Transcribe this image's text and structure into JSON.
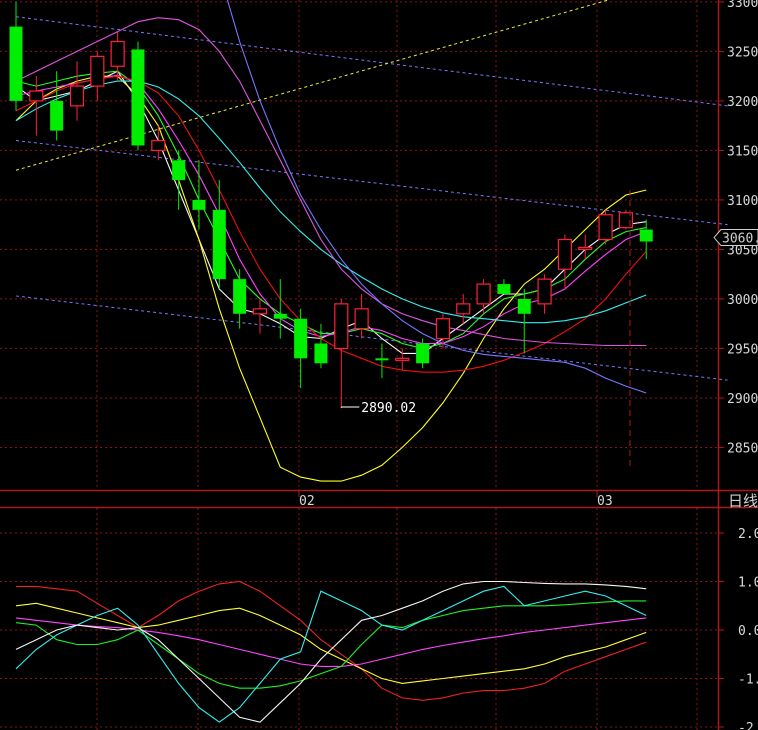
{
  "chart_title": "",
  "period_label": "日线",
  "colors": {
    "background": "#000000",
    "frame": "#b01818",
    "grid": "#8a1515",
    "up": "#ff1f3c",
    "down": "#00ee00"
  },
  "chart_data": [
    {
      "type": "candlestick",
      "panel": "price",
      "title": "",
      "ylim": [
        2805,
        3310
      ],
      "y_ticks": [
        "2850.",
        "2900.",
        "2950.",
        "3000.",
        "3050.",
        "3100.",
        "3150.",
        "3200.",
        "3250.",
        "3300."
      ],
      "y_tick_values": [
        2850,
        2900,
        2950,
        3000,
        3050,
        3100,
        3150,
        3200,
        3250,
        3300
      ],
      "x_ticks": [
        {
          "label": "02",
          "index": 14.5
        },
        {
          "label": "03",
          "index": 29.5
        }
      ],
      "current_price_label": "3060.",
      "current_price": 3062,
      "low_annotation": {
        "text": "2890.02",
        "index": 16,
        "value": 2890.02
      },
      "candles": [
        {
          "o": 3275,
          "h": 3300,
          "l": 3190,
          "c": 3200
        },
        {
          "o": 3200,
          "h": 3225,
          "l": 3165,
          "c": 3210
        },
        {
          "o": 3200,
          "h": 3230,
          "l": 3160,
          "c": 3170
        },
        {
          "o": 3195,
          "h": 3240,
          "l": 3180,
          "c": 3215
        },
        {
          "o": 3215,
          "h": 3250,
          "l": 3200,
          "c": 3245
        },
        {
          "o": 3235,
          "h": 3270,
          "l": 3220,
          "c": 3260
        },
        {
          "o": 3252,
          "h": 3260,
          "l": 3150,
          "c": 3155
        },
        {
          "o": 3150,
          "h": 3175,
          "l": 3140,
          "c": 3160
        },
        {
          "o": 3140,
          "h": 3150,
          "l": 3090,
          "c": 3120
        },
        {
          "o": 3100,
          "h": 3140,
          "l": 3070,
          "c": 3090
        },
        {
          "o": 3090,
          "h": 3120,
          "l": 3010,
          "c": 3020
        },
        {
          "o": 3020,
          "h": 3030,
          "l": 2970,
          "c": 2985
        },
        {
          "o": 2985,
          "h": 3000,
          "l": 2965,
          "c": 2990
        },
        {
          "o": 2985,
          "h": 3020,
          "l": 2960,
          "c": 2980
        },
        {
          "o": 2980,
          "h": 2990,
          "l": 2910,
          "c": 2940
        },
        {
          "o": 2955,
          "h": 2975,
          "l": 2930,
          "c": 2935
        },
        {
          "o": 2950,
          "h": 3000,
          "l": 2890.02,
          "c": 2995
        },
        {
          "o": 2970,
          "h": 3005,
          "l": 2960,
          "c": 2990
        },
        {
          "o": 2940,
          "h": 2955,
          "l": 2920,
          "c": 2938
        },
        {
          "o": 2938,
          "h": 2950,
          "l": 2928,
          "c": 2940
        },
        {
          "o": 2955,
          "h": 2960,
          "l": 2930,
          "c": 2935
        },
        {
          "o": 2960,
          "h": 2985,
          "l": 2950,
          "c": 2980
        },
        {
          "o": 2985,
          "h": 3005,
          "l": 2975,
          "c": 2995
        },
        {
          "o": 2995,
          "h": 3020,
          "l": 2985,
          "c": 3015
        },
        {
          "o": 3015,
          "h": 3020,
          "l": 3005,
          "c": 3005
        },
        {
          "o": 3000,
          "h": 3010,
          "l": 2945,
          "c": 2985
        },
        {
          "o": 2995,
          "h": 3025,
          "l": 2985,
          "c": 3020
        },
        {
          "o": 3030,
          "h": 3065,
          "l": 3010,
          "c": 3060
        },
        {
          "o": 3050,
          "h": 3065,
          "l": 3040,
          "c": 3052
        },
        {
          "o": 3060,
          "h": 3090,
          "l": 3055,
          "c": 3085
        },
        {
          "o": 3072,
          "h": 3090,
          "l": 3070,
          "c": 3087
        },
        {
          "o": 3070,
          "h": 3080,
          "l": 3040,
          "c": 3058
        }
      ],
      "overlays": [
        {
          "color": "#f5f5f5",
          "values": [
            3215,
            3200,
            3205,
            3210,
            3220,
            3230,
            3200,
            3160,
            3110,
            3060,
            3010,
            2990,
            2985,
            2975,
            2962,
            2960,
            2970,
            2978,
            2960,
            2945,
            2945,
            2960,
            2975,
            2990,
            3005,
            3005,
            3010,
            3030,
            3050,
            3065,
            3075,
            3078
          ]
        },
        {
          "color": "#ffff22",
          "values": [
            3180,
            3200,
            3212,
            3220,
            3225,
            3225,
            3205,
            3175,
            3120,
            3060,
            2990,
            2930,
            2880,
            2830,
            2820,
            2816,
            2816,
            2822,
            2832,
            2850,
            2870,
            2895,
            2925,
            2960,
            2990,
            3015,
            3030,
            3050,
            3070,
            3090,
            3105,
            3110
          ]
        },
        {
          "color": "#22ff22",
          "values": [
            3220,
            3215,
            3220,
            3225,
            3228,
            3230,
            3215,
            3185,
            3145,
            3100,
            3060,
            3020,
            3000,
            2985,
            2975,
            2965,
            2965,
            2970,
            2965,
            2955,
            2950,
            2955,
            2965,
            2985,
            3000,
            3005,
            3010,
            3020,
            3040,
            3058,
            3068,
            3072
          ]
        },
        {
          "color": "#ff44ff",
          "values": [
            3205,
            3210,
            3214,
            3218,
            3222,
            3226,
            3218,
            3192,
            3160,
            3125,
            3085,
            3040,
            3005,
            2980,
            2968,
            2962,
            2966,
            2972,
            2968,
            2960,
            2955,
            2955,
            2962,
            2972,
            2985,
            2995,
            3000,
            3010,
            3028,
            3045,
            3060,
            3068
          ]
        },
        {
          "color": "#ee1111",
          "values": [
            3190,
            3200,
            3210,
            3218,
            3222,
            3225,
            3220,
            3208,
            3185,
            3150,
            3110,
            3068,
            3030,
            3000,
            2978,
            2960,
            2948,
            2940,
            2932,
            2928,
            2926,
            2926,
            2928,
            2932,
            2938,
            2946,
            2955,
            2967,
            2980,
            3000,
            3025,
            3048
          ]
        },
        {
          "color": "#33eeee",
          "values": [
            3180,
            3192,
            3202,
            3210,
            3216,
            3220,
            3220,
            3214,
            3202,
            3185,
            3162,
            3138,
            3112,
            3088,
            3068,
            3050,
            3035,
            3022,
            3010,
            3000,
            2992,
            2986,
            2982,
            2980,
            2978,
            2976,
            2976,
            2978,
            2982,
            2988,
            2996,
            3004
          ]
        },
        {
          "color": "#dd55dd",
          "values": [
            3220,
            3230,
            3240,
            3250,
            3260,
            3270,
            3280,
            3284,
            3282,
            3272,
            3250,
            3220,
            3180,
            3140,
            3100,
            3060,
            3030,
            3010,
            2995,
            2985,
            2978,
            2972,
            2968,
            2964,
            2960,
            2958,
            2956,
            2955,
            2954,
            2953,
            2953,
            2953
          ]
        },
        {
          "color": "#7777ff",
          "values": [
            3420,
            3450,
            3480,
            3510,
            3530,
            3540,
            3530,
            3500,
            3460,
            3400,
            3330,
            3260,
            3200,
            3150,
            3105,
            3070,
            3040,
            3015,
            2995,
            2978,
            2965,
            2955,
            2948,
            2944,
            2942,
            2940,
            2938,
            2936,
            2930,
            2920,
            2912,
            2905
          ]
        }
      ],
      "trend_lines": [
        {
          "color": "#7777ff",
          "style": "dash",
          "from": [
            0,
            3285
          ],
          "to": [
            35,
            3195
          ]
        },
        {
          "color": "#7777ff",
          "style": "dash",
          "from": [
            0,
            3160
          ],
          "to": [
            35,
            3075
          ]
        },
        {
          "color": "#7777ff",
          "style": "dash",
          "from": [
            0,
            3003
          ],
          "to": [
            35,
            2918
          ]
        },
        {
          "color": "#eeee33",
          "style": "dash",
          "from": [
            0,
            3130
          ],
          "to": [
            30.5,
            3310
          ]
        }
      ],
      "markers": [
        {
          "kind": "dashed-vline",
          "index": 30.2,
          "color": "#b01818"
        }
      ]
    },
    {
      "type": "line",
      "panel": "indicator",
      "title": "",
      "ylim": [
        -2.0,
        2.2
      ],
      "y_ticks": [
        "2.0",
        "1.0",
        "0.0",
        "-1.0",
        "-2.0"
      ],
      "y_tick_values": [
        2.0,
        1.0,
        0.0,
        -1.0,
        -2.0
      ],
      "series": [
        {
          "color": "#ee2222",
          "values": [
            0.9,
            0.9,
            0.85,
            0.8,
            0.55,
            0.3,
            0.05,
            0.3,
            0.6,
            0.8,
            0.95,
            1.0,
            0.8,
            0.5,
            0.2,
            -0.2,
            -0.5,
            -0.8,
            -1.2,
            -1.4,
            -1.45,
            -1.4,
            -1.3,
            -1.25,
            -1.25,
            -1.2,
            -1.1,
            -0.85,
            -0.7,
            -0.55,
            -0.4,
            -0.25
          ]
        },
        {
          "color": "#ffff33",
          "values": [
            0.5,
            0.55,
            0.45,
            0.35,
            0.25,
            0.15,
            0.05,
            0.1,
            0.2,
            0.3,
            0.4,
            0.45,
            0.3,
            0.1,
            -0.1,
            -0.4,
            -0.6,
            -0.8,
            -1.0,
            -1.1,
            -1.05,
            -1.0,
            -0.95,
            -0.9,
            -0.85,
            -0.8,
            -0.7,
            -0.55,
            -0.45,
            -0.35,
            -0.2,
            -0.05
          ]
        },
        {
          "color": "#ff44ff",
          "values": [
            0.25,
            0.2,
            0.15,
            0.1,
            0.07,
            0.05,
            0.0,
            -0.05,
            -0.12,
            -0.2,
            -0.3,
            -0.4,
            -0.5,
            -0.6,
            -0.7,
            -0.75,
            -0.75,
            -0.7,
            -0.6,
            -0.5,
            -0.4,
            -0.32,
            -0.25,
            -0.18,
            -0.12,
            -0.05,
            0.0,
            0.05,
            0.1,
            0.15,
            0.2,
            0.25
          ]
        },
        {
          "color": "#22ee22",
          "values": [
            0.15,
            0.1,
            -0.2,
            -0.3,
            -0.3,
            -0.2,
            0.0,
            -0.3,
            -0.6,
            -0.9,
            -1.1,
            -1.2,
            -1.2,
            -1.15,
            -1.05,
            -0.9,
            -0.75,
            -0.3,
            0.1,
            0.05,
            0.2,
            0.3,
            0.4,
            0.45,
            0.5,
            0.5,
            0.5,
            0.52,
            0.55,
            0.58,
            0.6,
            0.6
          ]
        },
        {
          "color": "#33eeee",
          "values": [
            -0.8,
            -0.4,
            -0.1,
            0.1,
            0.3,
            0.45,
            0.1,
            -0.5,
            -1.1,
            -1.6,
            -1.9,
            -1.6,
            -1.1,
            -0.6,
            -0.45,
            0.8,
            0.6,
            0.4,
            0.1,
            0.0,
            0.2,
            0.4,
            0.6,
            0.8,
            0.9,
            0.5,
            0.6,
            0.7,
            0.8,
            0.7,
            0.5,
            0.3
          ]
        },
        {
          "color": "#f5f5f5",
          "values": [
            -0.4,
            -0.2,
            0.0,
            0.1,
            0.05,
            0.0,
            0.05,
            -0.2,
            -0.6,
            -1.0,
            -1.4,
            -1.8,
            -1.9,
            -1.5,
            -1.1,
            -0.6,
            -0.2,
            0.2,
            0.3,
            0.45,
            0.6,
            0.8,
            0.95,
            1.0,
            1.0,
            0.98,
            0.96,
            0.95,
            0.95,
            0.93,
            0.9,
            0.85
          ]
        }
      ]
    }
  ]
}
